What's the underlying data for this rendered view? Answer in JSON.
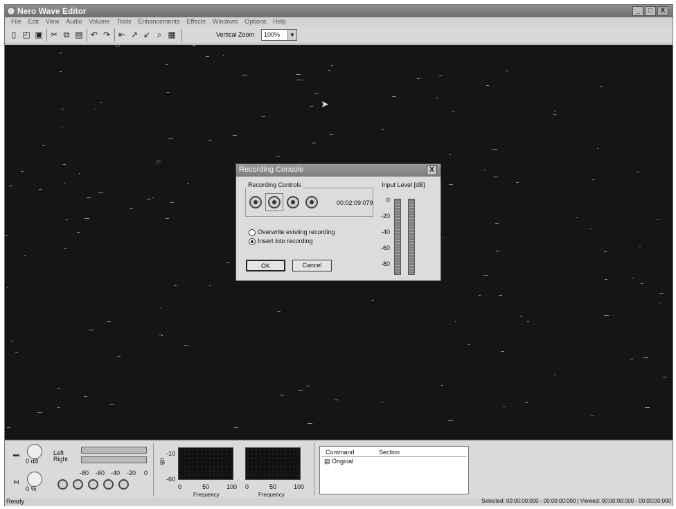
{
  "app": {
    "title": "Nero Wave Editor",
    "icon": "app-icon"
  },
  "window_controls": {
    "minimize": "_",
    "maximize": "□",
    "close": "X"
  },
  "menu": [
    "File",
    "Edit",
    "View",
    "Audio",
    "Volume",
    "Tools",
    "Enhancements",
    "Effects",
    "Windows",
    "Options",
    "Help"
  ],
  "toolbar": {
    "icons": [
      "new-icon",
      "open-icon",
      "save-icon",
      "cut-icon",
      "copy-icon",
      "paste-icon",
      "undo-icon",
      "redo-icon",
      "fit-icon",
      "zoom-in-icon",
      "zoom-out-icon",
      "zoom-select-icon",
      "zoom-fit-icon"
    ],
    "vertical_zoom_label": "Vertical Zoom",
    "zoom_value": "100%"
  },
  "dialog": {
    "title": "Recording Console",
    "close": "X",
    "recording_controls_label": "Recording Controls",
    "timecode": "00:02:09:079",
    "options": [
      {
        "label": "Overwrite existing recording",
        "selected": false
      },
      {
        "label": "Insert into recording",
        "selected": true
      }
    ],
    "ok_label": "OK",
    "cancel_label": "Cancel",
    "input_level_label": "Input Level [dB]",
    "level_ticks": [
      "0",
      "-20",
      "-40",
      "-60",
      "-80"
    ]
  },
  "bottom": {
    "balance_left": "Left",
    "balance_right": "Right",
    "volume_db": "0 dB",
    "speed_pct": "0 %",
    "vu_ticks": [
      "-80",
      "-60",
      "-40",
      "-20",
      "0"
    ],
    "spectrum_y_ticks": [
      "-10",
      "-60"
    ],
    "spectrum_y_label": "dB",
    "spectrum1_x_ticks": [
      "0",
      "50",
      "100"
    ],
    "spectrum2_x_ticks": [
      "0",
      "50",
      "100"
    ],
    "spectrum_x_label": "Frequency",
    "history_headers": {
      "command": "Command",
      "section": "Section"
    },
    "history_rows": [
      "Original"
    ]
  },
  "status": {
    "left": "Ready",
    "right": "Selected: 00:00:00:000 - 00:00:00:000 | Viewed: 00:00:00:000 - 00:00:00:000"
  }
}
